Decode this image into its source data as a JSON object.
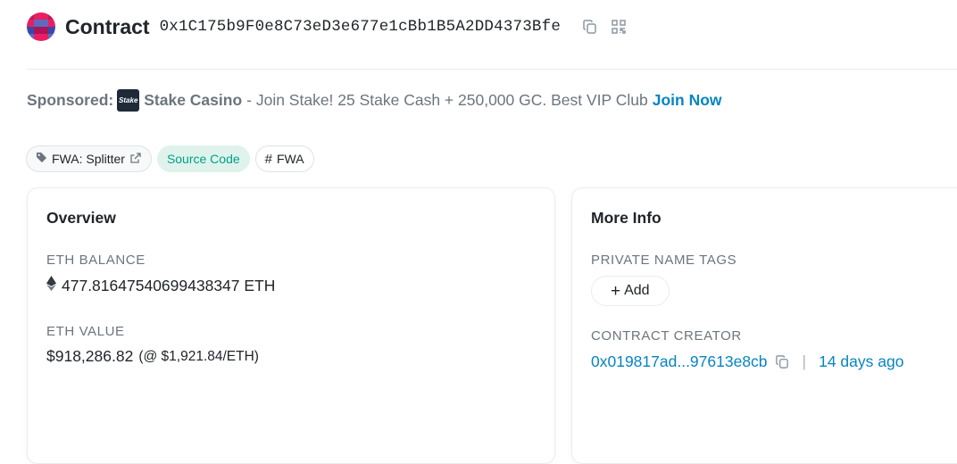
{
  "header": {
    "title": "Contract",
    "address": "0x1C175b9F0e8C73eD3e677e1cBb1B5A2DD4373Bfe",
    "copy_icon": "copy-icon",
    "qr_icon": "qr-code-icon"
  },
  "sponsored": {
    "label": "Sponsored:",
    "logo_text": "Stake",
    "brand": "Stake Casino",
    "description": "- Join Stake! 25 Stake Cash + 250,000 GC. Best VIP Club",
    "cta": "Join Now"
  },
  "tags": [
    {
      "label": "FWA: Splitter",
      "icon": "tag-icon",
      "trail_icon": "external-link-icon"
    },
    {
      "label": "Source Code"
    },
    {
      "label": "FWA",
      "icon": "hash-icon"
    }
  ],
  "overview": {
    "title": "Overview",
    "eth_balance_label": "ETH BALANCE",
    "eth_balance_value": "477.81647540699438347 ETH",
    "eth_value_label": "ETH VALUE",
    "eth_value_value": "$918,286.82",
    "eth_value_rate": "(@ $1,921.84/ETH)"
  },
  "more_info": {
    "title": "More Info",
    "private_tags_label": "PRIVATE NAME TAGS",
    "add_label": "Add",
    "creator_label": "CONTRACT CREATOR",
    "creator_address": "0x019817ad...97613e8cb",
    "separator": "|",
    "creator_age": "14 days ago"
  },
  "colors": {
    "link": "#0784c3",
    "source_bg": "#dff3ec",
    "source_text": "#00a186"
  }
}
